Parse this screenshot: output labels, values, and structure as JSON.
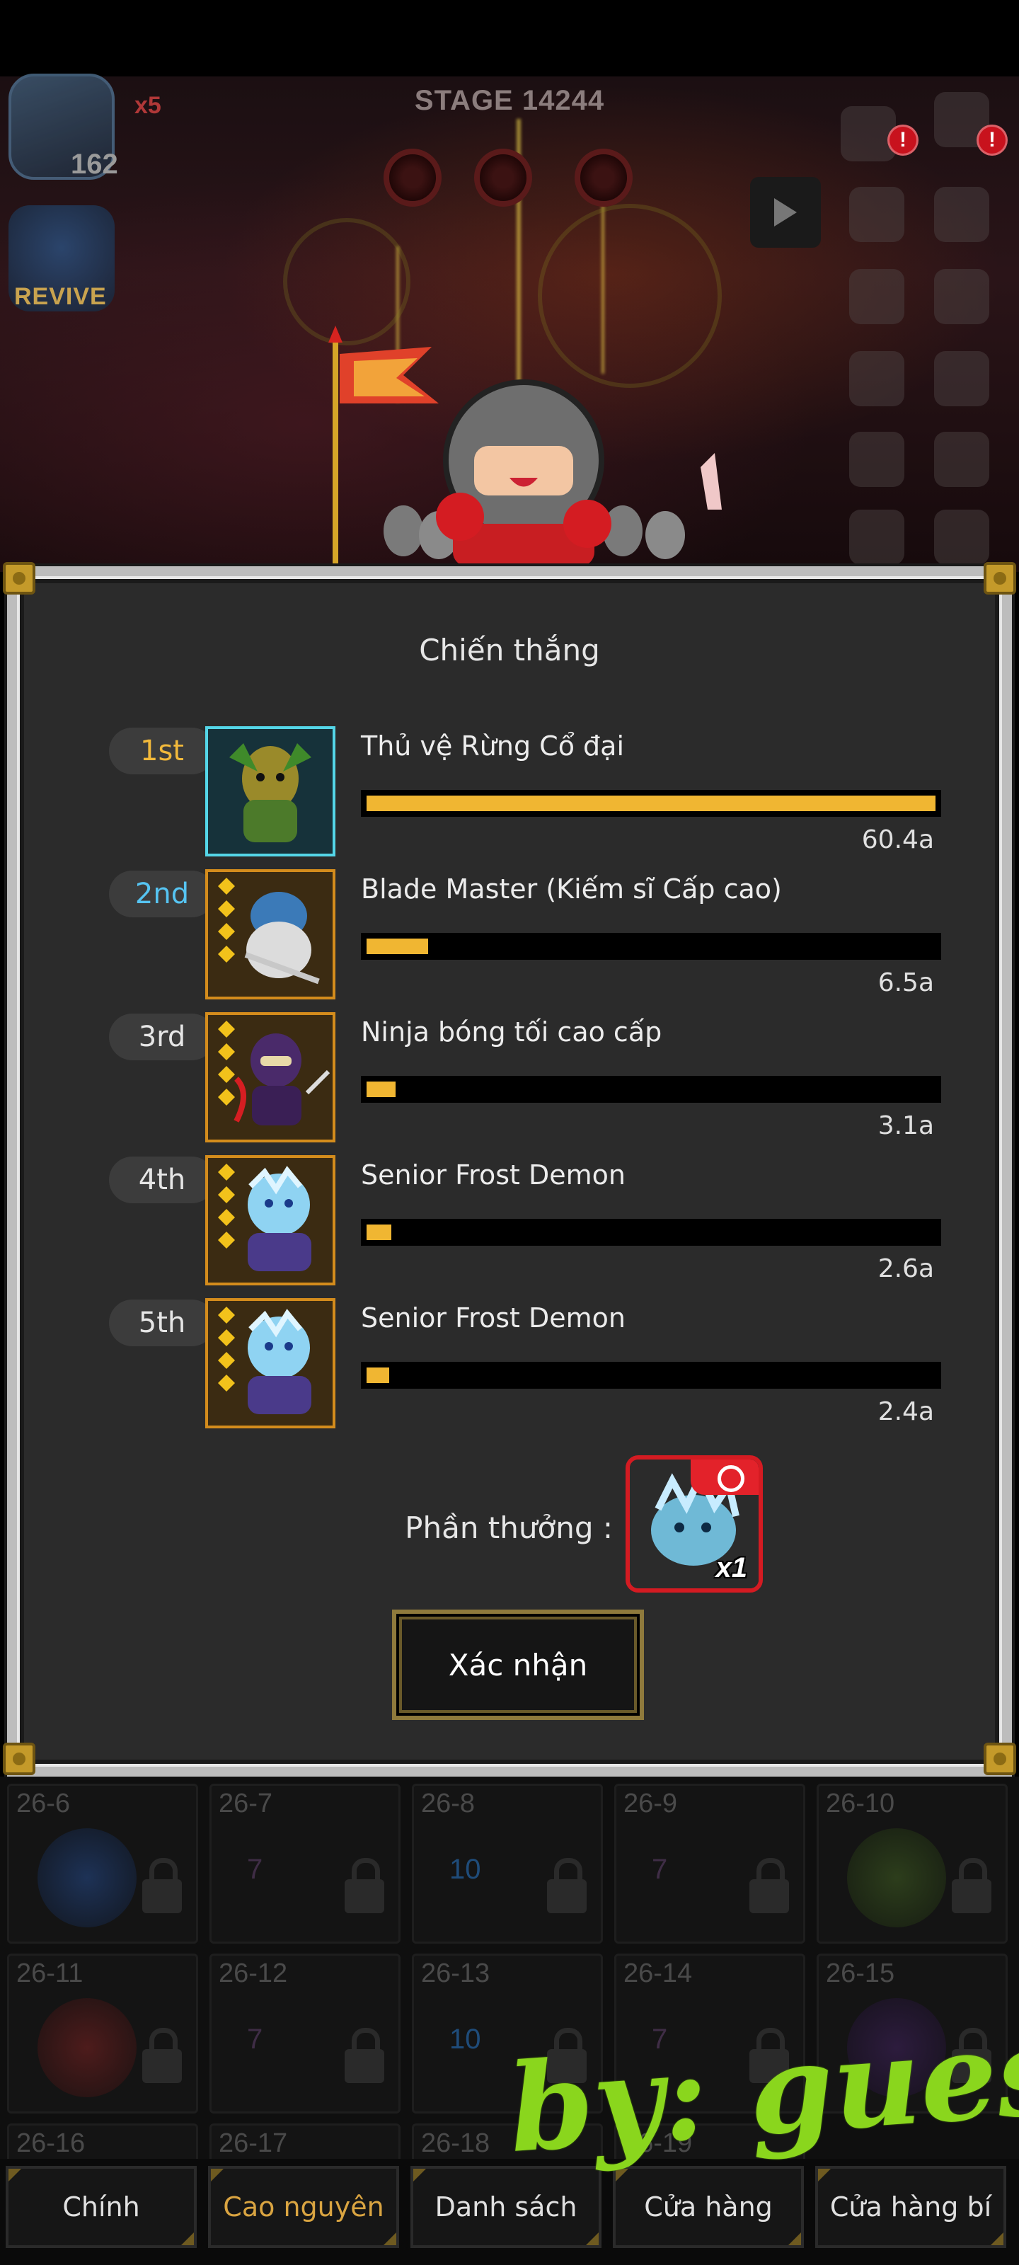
{
  "hud": {
    "stage_label": "STAGE 14244",
    "hero_level": "162",
    "kill_counter": "x5",
    "revive_label": "REVIVE",
    "alert_badge": "!"
  },
  "dialog": {
    "title": "Chiến thắng",
    "rankings": [
      {
        "rank": "1st",
        "name": "Thủ vệ Rừng Cổ đại",
        "damage": "60.4a",
        "damage_value": 60.4
      },
      {
        "rank": "2nd",
        "name": "Blade Master (Kiếm sĩ Cấp cao)",
        "damage": "6.5a",
        "damage_value": 6.5
      },
      {
        "rank": "3rd",
        "name": "Ninja bóng tối cao cấp",
        "damage": "3.1a",
        "damage_value": 3.1
      },
      {
        "rank": "4th",
        "name": "Senior Frost Demon",
        "damage": "2.6a",
        "damage_value": 2.6
      },
      {
        "rank": "5th",
        "name": "Senior Frost Demon",
        "damage": "2.4a",
        "damage_value": 2.4
      }
    ],
    "reward_label": "Phần thưởng :",
    "reward_quantity": "x1",
    "confirm_label": "Xác nhận"
  },
  "stage_grid": [
    {
      "label": "26-6",
      "reward": ""
    },
    {
      "label": "26-7",
      "reward": "7",
      "kind": "orb"
    },
    {
      "label": "26-8",
      "reward": "10",
      "kind": "gem"
    },
    {
      "label": "26-9",
      "reward": "7",
      "kind": "orb"
    },
    {
      "label": "26-10",
      "reward": ""
    },
    {
      "label": "26-11",
      "reward": ""
    },
    {
      "label": "26-12",
      "reward": "7",
      "kind": "orb"
    },
    {
      "label": "26-13",
      "reward": "10",
      "kind": "gem"
    },
    {
      "label": "26-14",
      "reward": "7",
      "kind": "orb"
    },
    {
      "label": "26-15",
      "reward": ""
    },
    {
      "label": "26-16",
      "reward": ""
    },
    {
      "label": "26-17",
      "reward": ""
    },
    {
      "label": "26-18",
      "reward": ""
    },
    {
      "label": "26-19",
      "reward": ""
    }
  ],
  "bottom_nav": [
    {
      "label": "Chính"
    },
    {
      "label": "Cao nguyên"
    },
    {
      "label": "Danh sách"
    },
    {
      "label": "Cửa hàng"
    },
    {
      "label": "Cửa hàng bí"
    }
  ],
  "watermark": "by: guest",
  "colors": {
    "bar_fill": "#f0b632",
    "rank_gold": "#f2b93b",
    "rank_blue": "#56c4f2",
    "reward_border": "#d41b22",
    "active_tab": "#d9a441",
    "watermark": "#8ad61d"
  }
}
